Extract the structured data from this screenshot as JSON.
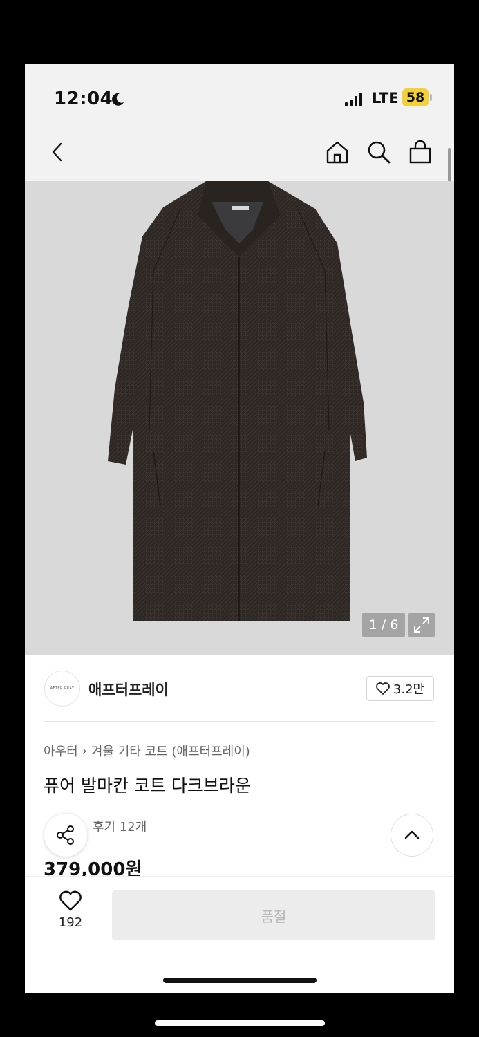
{
  "status_bar": {
    "time": "12:04",
    "network": "LTE",
    "battery": "58"
  },
  "nav": {
    "icons": [
      "back-icon",
      "home-icon",
      "search-icon",
      "bag-icon"
    ]
  },
  "image": {
    "counter": "1 / 6"
  },
  "brand": {
    "logo_text": "AFTER PRAY",
    "name": "애프터프레이",
    "likes": "3.2만"
  },
  "product": {
    "breadcrumb": [
      "아우터",
      "겨울 기타 코트 (애프터프레이)"
    ],
    "title": "퓨어 발마칸 코트 다크브라운",
    "reviews": "후기 12개",
    "price": "379,000원"
  },
  "bottom_bar": {
    "wish_count": "192",
    "cta_label": "품절"
  },
  "colors": {
    "coat": "#2e2824",
    "image_bg": "#d9d9d9",
    "battery": "#f3d03e",
    "cta_bg": "#ececec"
  }
}
